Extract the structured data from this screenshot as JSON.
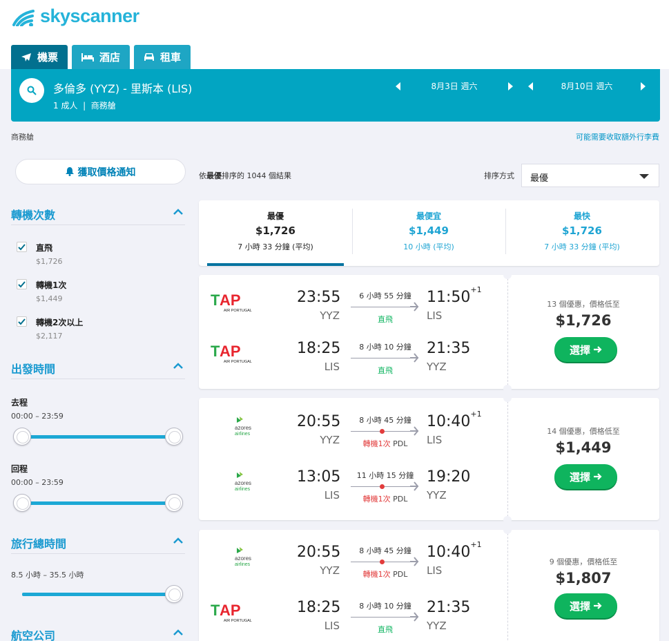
{
  "brand": {
    "name": "skyscanner"
  },
  "tabs": [
    {
      "label": "機票",
      "icon": "plane-icon"
    },
    {
      "label": "酒店",
      "icon": "bed-icon"
    },
    {
      "label": "租車",
      "icon": "car-icon"
    }
  ],
  "search": {
    "route": "多倫多 (YYZ) - 里斯本 (LIS)",
    "pax": "1 成人",
    "cabin": "商務艙",
    "out_date": "8月3日 週六",
    "ret_date": "8月10日 週六"
  },
  "cabin_label": "商務艙",
  "baggage_link": "可能需要收取額外行李費",
  "price_alert": "獲取價格通知",
  "filters": {
    "stops": {
      "title": "轉機次數",
      "items": [
        {
          "label": "直飛",
          "price": "$1,726"
        },
        {
          "label": "轉機1次",
          "price": "$1,449"
        },
        {
          "label": "轉機2次以上",
          "price": "$2,117"
        }
      ]
    },
    "times": {
      "title": "出發時間",
      "outbound": "去程",
      "outbound_range": "00:00 – 23:59",
      "return": "回程",
      "return_range": "00:00 – 23:59"
    },
    "duration": {
      "title": "旅行總時間",
      "range": "8.5 小時 – 35.5 小時"
    },
    "airlines": {
      "title": "航空公司"
    }
  },
  "results": {
    "prefix": "依",
    "sort_key": "最優",
    "mid": "排序的",
    "count": "1044",
    "suffix": "個結果",
    "sort_label": "排序方式",
    "sort_value": "最優"
  },
  "summary": [
    {
      "title": "最優",
      "price": "$1,726",
      "duration": "7 小時 33 分鐘 (平均)"
    },
    {
      "title": "最便宜",
      "price": "$1,449",
      "duration": "10 小時 (平均)"
    },
    {
      "title": "最快",
      "price": "$1,726",
      "duration": "7 小時 33 分鐘 (平均)"
    }
  ],
  "cards": [
    {
      "deals": "13 個優惠，價格低至",
      "price": "$1,726",
      "button": "選擇",
      "legs": [
        {
          "airline": "TAP AIR PORTUGAL",
          "dep": "23:55",
          "dep_code": "YYZ",
          "duration": "6 小時 55 分鐘",
          "stops": "直飛",
          "arr": "11:50",
          "plus": "+1",
          "arr_code": "LIS"
        },
        {
          "airline": "TAP AIR PORTUGAL",
          "dep": "18:25",
          "dep_code": "LIS",
          "duration": "8 小時 10 分鐘",
          "stops": "直飛",
          "arr": "21:35",
          "plus": "",
          "arr_code": "YYZ"
        }
      ]
    },
    {
      "deals": "14 個優惠，價格低至",
      "price": "$1,449",
      "button": "選擇",
      "legs": [
        {
          "airline": "azores airlines",
          "dep": "20:55",
          "dep_code": "YYZ",
          "duration": "8 小時 45 分鐘",
          "stops": "轉機1次",
          "via": "PDL",
          "arr": "10:40",
          "plus": "+1",
          "arr_code": "LIS"
        },
        {
          "airline": "azores airlines",
          "dep": "13:05",
          "dep_code": "LIS",
          "duration": "11 小時 15 分鐘",
          "stops": "轉機1次",
          "via": "PDL",
          "arr": "19:20",
          "plus": "",
          "arr_code": "YYZ"
        }
      ]
    },
    {
      "deals": "9 個優惠，價格低至",
      "price": "$1,807",
      "button": "選擇",
      "legs": [
        {
          "airline": "azores airlines",
          "dep": "20:55",
          "dep_code": "YYZ",
          "duration": "8 小時 45 分鐘",
          "stops": "轉機1次",
          "via": "PDL",
          "arr": "10:40",
          "plus": "+1",
          "arr_code": "LIS"
        },
        {
          "airline": "TAP AIR PORTUGAL",
          "dep": "18:25",
          "dep_code": "LIS",
          "duration": "8 小時 10 分鐘",
          "stops": "直飛",
          "arr": "21:35",
          "plus": "",
          "arr_code": "YYZ"
        }
      ]
    }
  ],
  "colors": {
    "brand": "#25b3d9",
    "search_bar": "#02a5c2",
    "tab_active": "#02708f",
    "select_button": "#0fb45e",
    "direct": "#10b561",
    "stop": "#e23c3c"
  }
}
